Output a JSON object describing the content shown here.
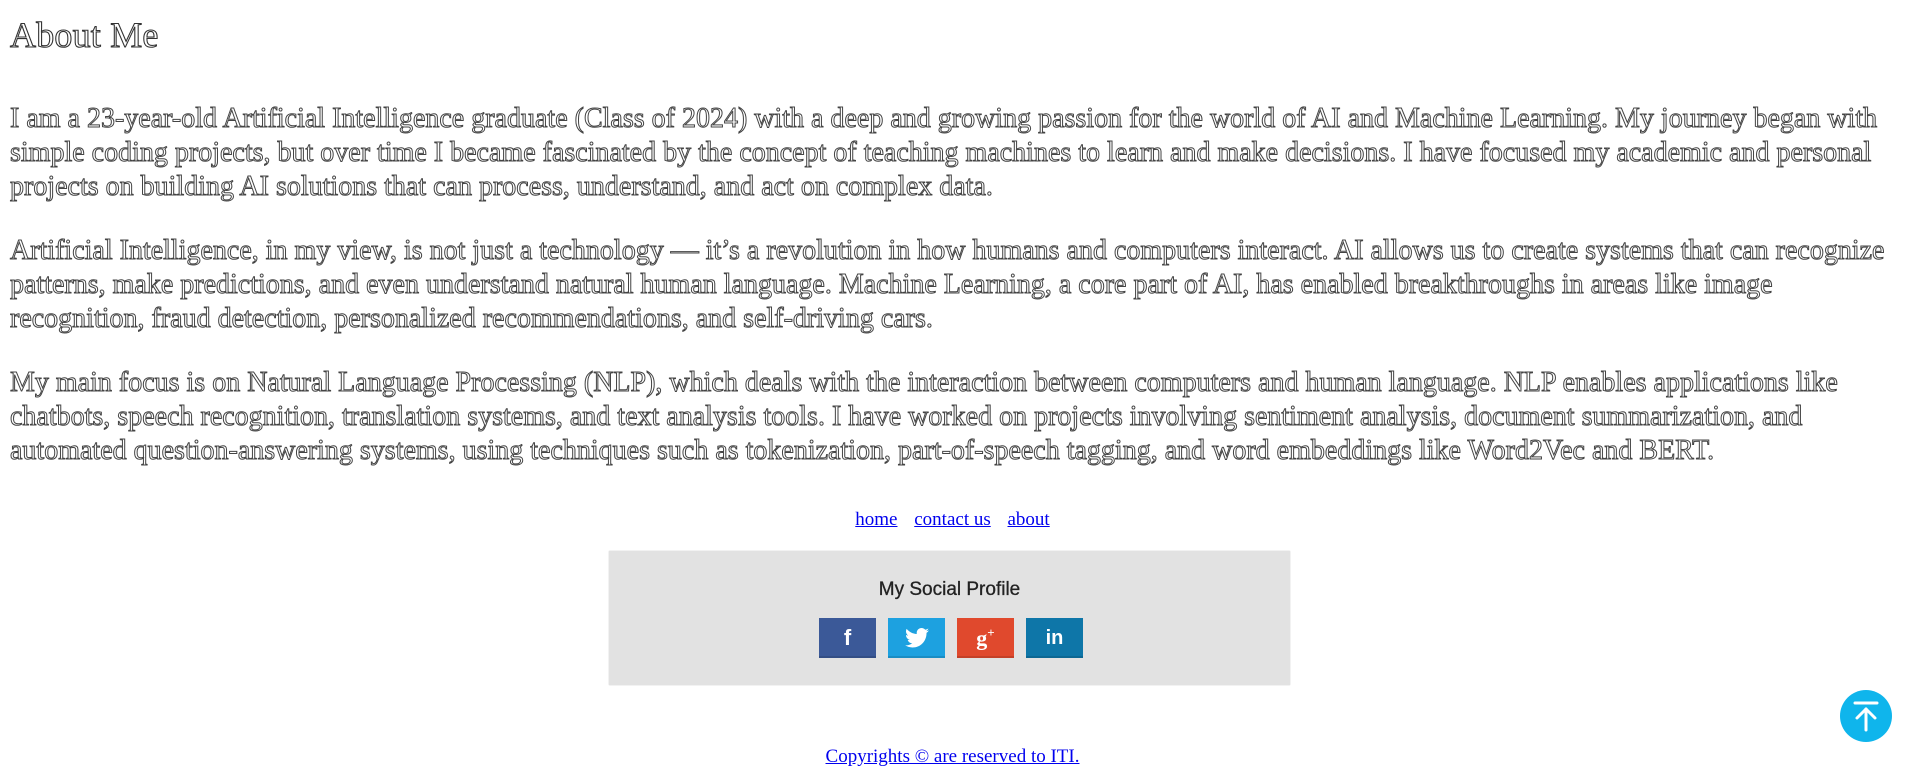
{
  "about": {
    "title": "About Me",
    "paragraphs": [
      "I am a 23-year-old Artificial Intelligence graduate (Class of 2024) with a deep and growing passion for the world of AI and Machine Learning. My journey began with simple coding projects, but over time I became fascinated by the concept of teaching machines to learn and make decisions. I have focused my academic and personal projects on building AI solutions that can process, understand, and act on complex data.",
      "Artificial Intelligence, in my view, is not just a technology — it’s a revolution in how humans and computers interact. AI allows us to create systems that can recognize patterns, make predictions, and even understand natural human language. Machine Learning, a core part of AI, has enabled breakthroughs in areas like image recognition, fraud detection, personalized recommendations, and self-driving cars.",
      "My main focus is on Natural Language Processing (NLP), which deals with the interaction between computers and human language. NLP enables applications like chatbots, speech recognition, translation systems, and text analysis tools. I have worked on projects involving sentiment analysis, document summarization, and automated question-answering systems, using techniques such as tokenization, part-of-speech tagging, and word embeddings like Word2Vec and BERT."
    ]
  },
  "nav": {
    "links": [
      "home",
      "contact us",
      "about"
    ]
  },
  "social": {
    "title": "My Social Profile",
    "buttons": [
      {
        "label": "f",
        "icon": "facebook-icon",
        "color": "#3b5998"
      },
      {
        "label": "twitter",
        "icon": "twitter-icon",
        "color": "#1da1e0"
      },
      {
        "label": "g+",
        "icon": "google-plus-icon",
        "color": "#e0492d"
      },
      {
        "label": "in",
        "icon": "linkedin-icon",
        "color": "#0e76a8"
      }
    ]
  },
  "back_to_top": {
    "icon": "arrow-up-icon",
    "color": "#0fb5ec"
  },
  "footer": {
    "copyright": "Copyrights © are reserved to ITI."
  }
}
